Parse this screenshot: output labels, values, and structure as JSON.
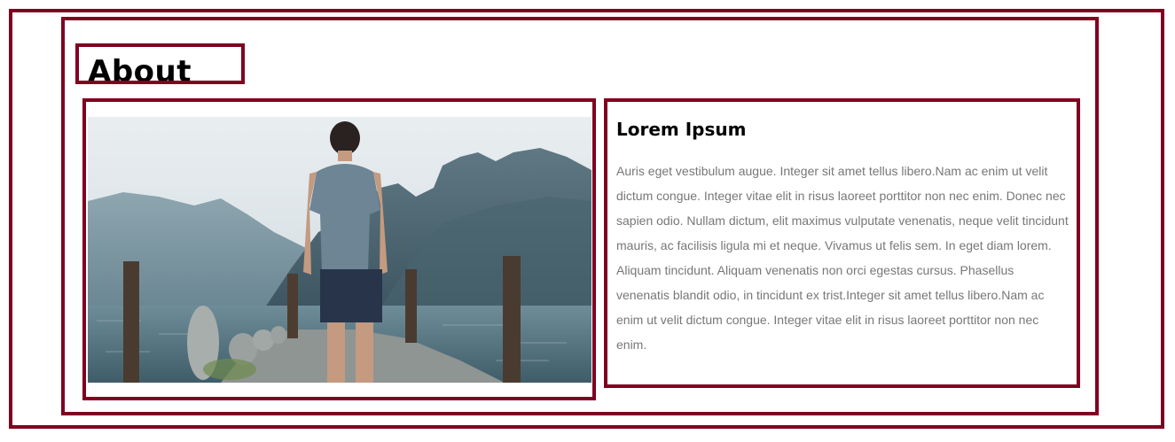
{
  "section": {
    "heading": "About Us"
  },
  "card": {
    "title": "Lorem Ipsum",
    "body": "Auris eget vestibulum augue. Integer sit amet tellus libero.Nam ac enim ut velit dictum congue. Integer vitae elit in risus laoreet porttitor non nec enim. Donec nec sapien odio. Nullam dictum, elit maximus vulputate venenatis, neque velit tincidunt mauris, ac facilisis ligula mi et neque. Vivamus ut felis sem. In eget diam lorem. Aliquam tincidunt. Aliquam venenatis non orci egestas cursus. Phasellus venenatis blandit odio, in tincidunt ex trist.Integer sit amet tellus libero.Nam ac enim ut velit dictum congue. Integer vitae elit in risus laoreet porttitor non nec enim."
  },
  "colors": {
    "border": "#800020",
    "body_text": "#777777"
  }
}
